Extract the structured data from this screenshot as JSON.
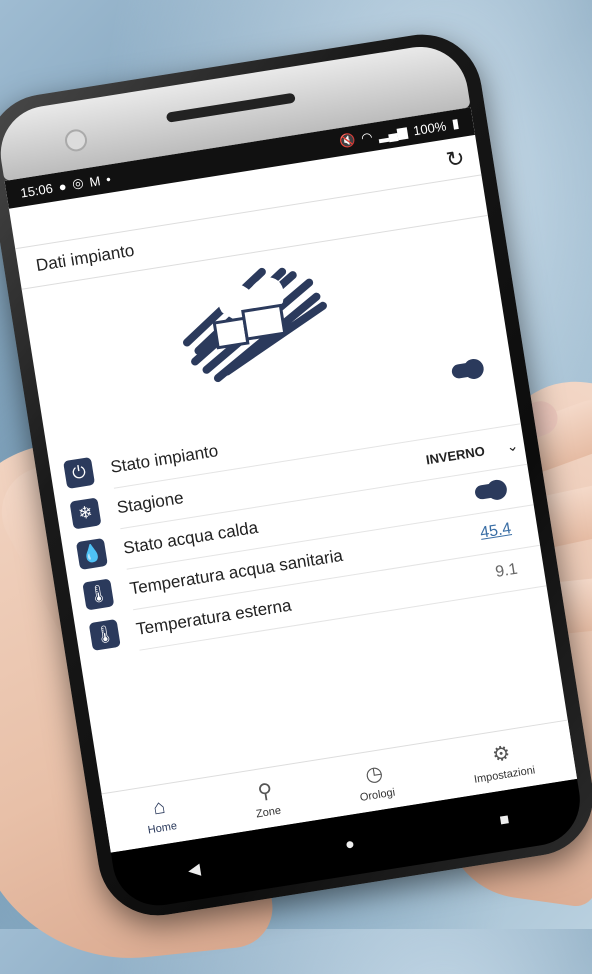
{
  "status": {
    "time": "15:06",
    "left_icons": [
      "account-icon",
      "instagram-icon",
      "gmail-icon"
    ],
    "dot": "•",
    "right_icons": [
      "mute-icon",
      "wifi-icon",
      "signal-icon"
    ],
    "battery": "100%"
  },
  "header": {
    "title": "Dati impianto"
  },
  "rows": [
    {
      "label": "Stato impianto",
      "icon": "power-icon",
      "glyph": "⏻"
    },
    {
      "label": "Stagione",
      "icon": "snowflake-icon",
      "glyph": "❄",
      "value": "INVERNO"
    },
    {
      "label": "Stato acqua calda",
      "icon": "water-drop-icon",
      "glyph": "💧"
    },
    {
      "label": "Temperatura acqua sanitaria",
      "icon": "water-temp-icon",
      "glyph": "🌡",
      "value": "45.4"
    },
    {
      "label": "Temperatura esterna",
      "icon": "thermometer-icon",
      "glyph": "🌡",
      "value": "9.1"
    }
  ],
  "nav": {
    "home": "Home",
    "zone": "Zone",
    "orologi": "Orologi",
    "impostazioni": "Impostazioni"
  },
  "colors": {
    "accent": "#2b3a5c",
    "link": "#3a6ea5"
  }
}
